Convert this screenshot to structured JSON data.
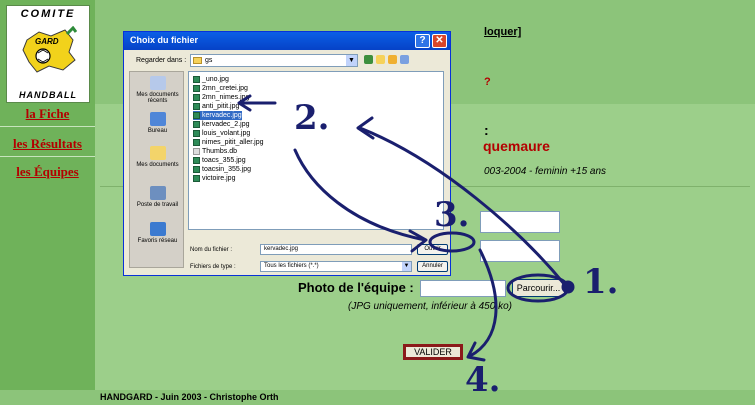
{
  "logo": {
    "top_text": "COMITE",
    "bottom_text": "HANDBALL",
    "map_text": "GARD"
  },
  "nav": {
    "fiche": "la Fiche",
    "resultats": "les Résultats",
    "equipes": "les Équipes"
  },
  "header": {
    "deconnect_partial": "loquer]"
  },
  "team": {
    "title_partial": "quemaure",
    "subtitle_partial": "003-2004 - feminin +15 ans"
  },
  "form": {
    "photo_label": "Photo de l'équipe :",
    "browse_label": "Parcourir...",
    "photo_hint": "(JPG uniquement, inférieur à 450 ko)",
    "submit_label": "VALIDER"
  },
  "footer": {
    "text": "HANDGARD - Juin 2003 - Christophe Orth"
  },
  "dialog": {
    "title": "Choix du fichier",
    "lookin_label": "Regarder dans :",
    "lookin_value": "gs",
    "places": [
      "Mes documents récents",
      "Bureau",
      "Mes documents",
      "Poste de travail",
      "Favoris réseau"
    ],
    "files": [
      "_uno.jpg",
      "2mn_cretei.jpg",
      "2mn_nimes.jpg",
      "anti_pitit.jpg",
      "kervadec.jpg",
      "kervadec_2.jpg",
      "louis_volant.jpg",
      "nimes_pitit_aller.jpg",
      "Thumbs.db",
      "toacs_355.jpg",
      "toacsin_355.jpg",
      "victoire.jpg"
    ],
    "selected_index": 4,
    "filename_label": "Nom du fichier :",
    "filename_value": "kervadec.jpg",
    "filetype_label": "Fichiers de type :",
    "filetype_value": "Tous les fichiers (*.*)",
    "open_label": "Ouvrir",
    "cancel_label": "Annuler"
  },
  "annotations": {
    "step1": "1.",
    "step2": "2.",
    "step3": "3.",
    "step4": "4.",
    "ink_color": "#1a1f6e"
  }
}
